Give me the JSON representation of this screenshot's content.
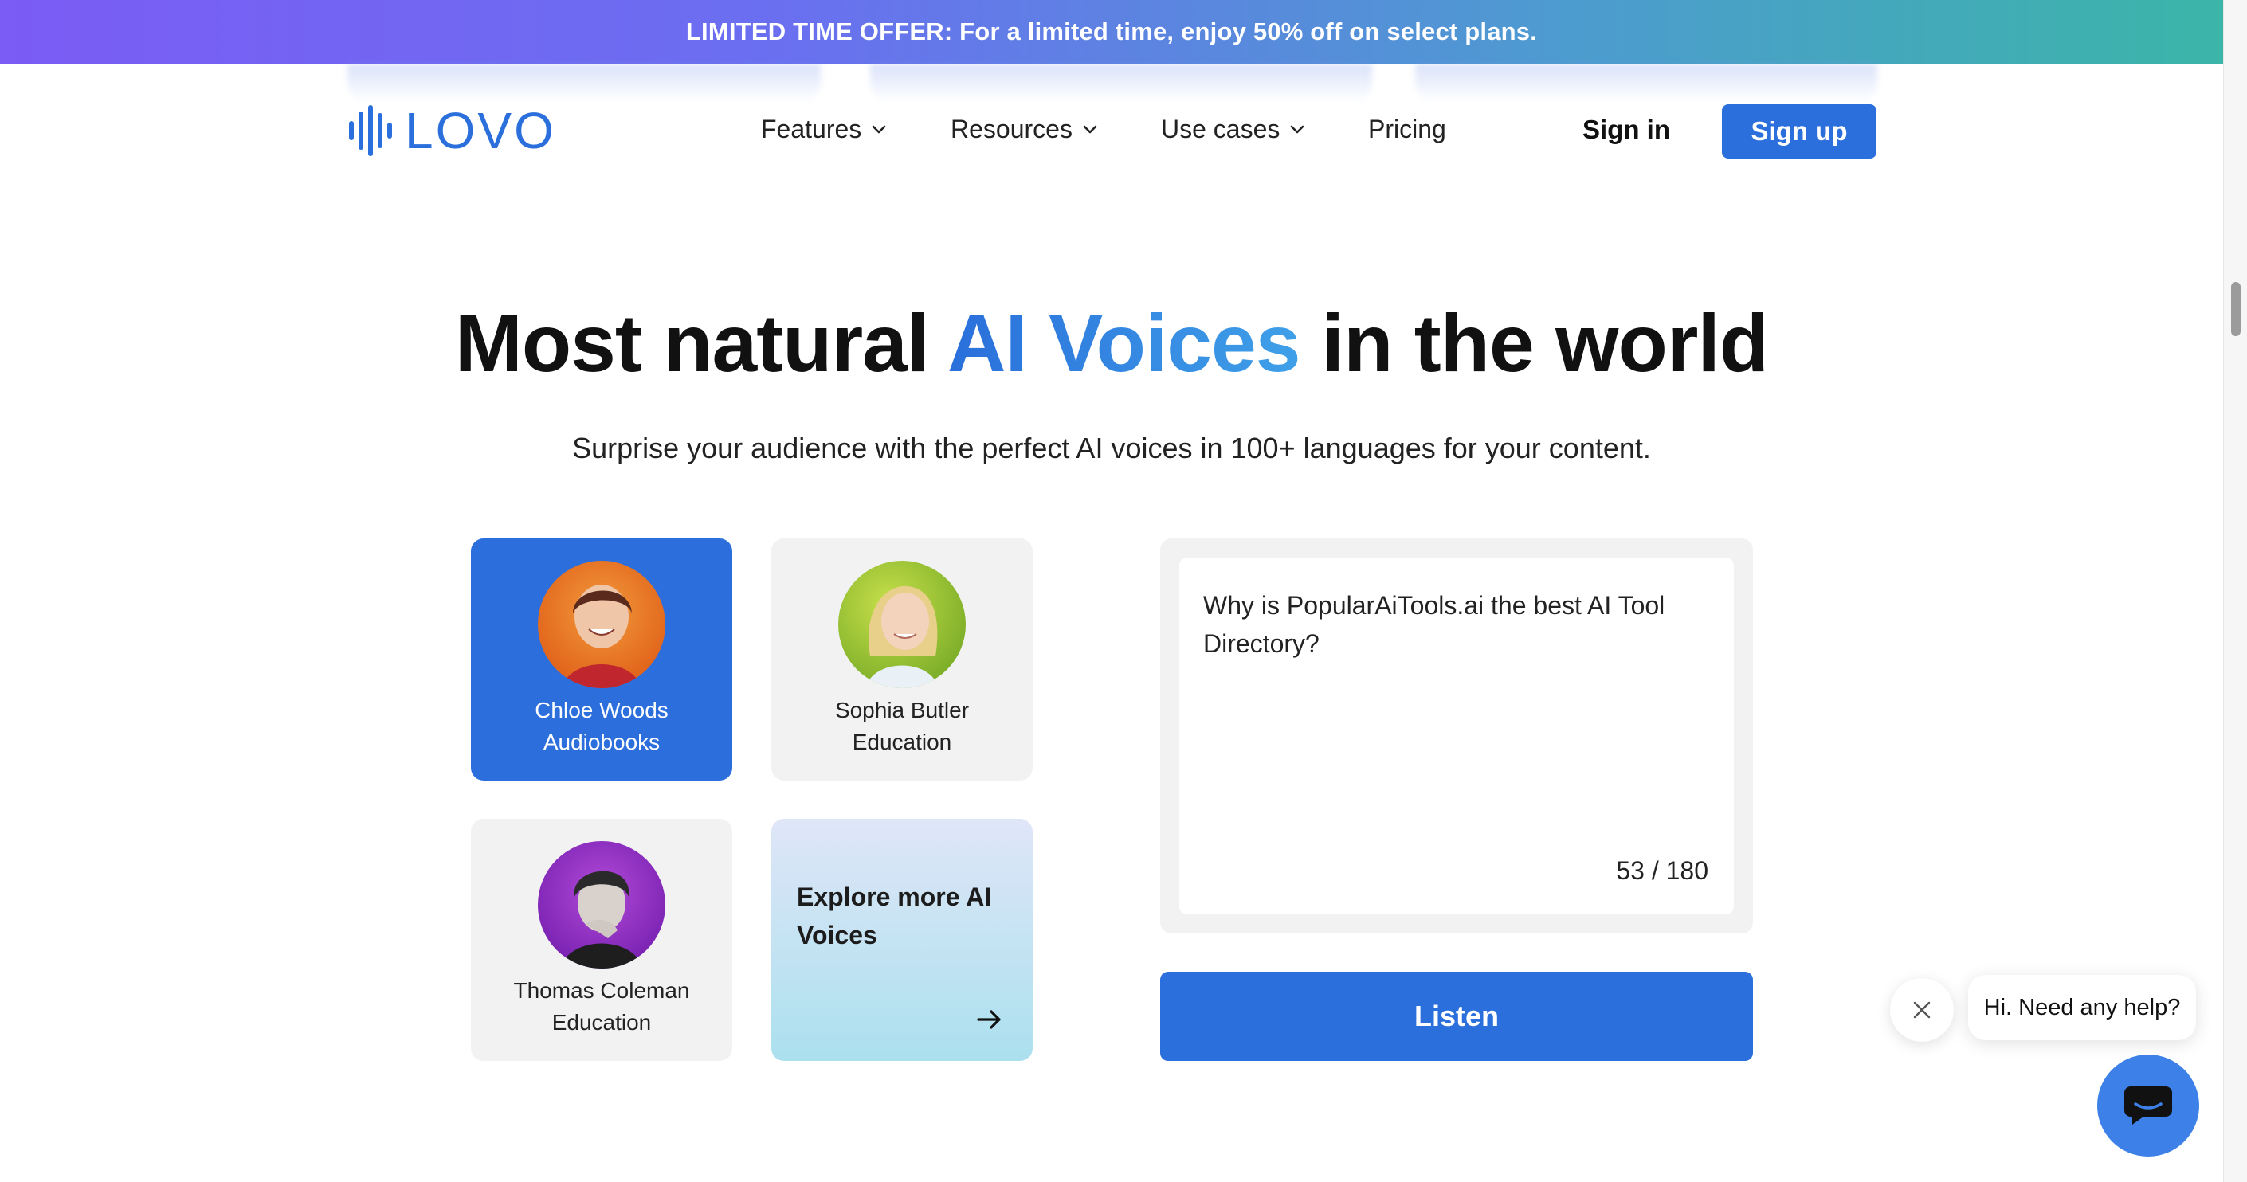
{
  "banner": {
    "text": "LIMITED TIME OFFER: For a limited time, enjoy 50% off on select plans."
  },
  "nav": {
    "logo_text": "LOVO",
    "items": [
      {
        "label": "Features",
        "has_dropdown": true
      },
      {
        "label": "Resources",
        "has_dropdown": true
      },
      {
        "label": "Use cases",
        "has_dropdown": true
      },
      {
        "label": "Pricing",
        "has_dropdown": false
      }
    ],
    "sign_in": "Sign in",
    "sign_up": "Sign up"
  },
  "hero": {
    "headline_before": "Most natural ",
    "headline_accent": "AI Voices",
    "headline_after": " in the world",
    "subheadline": "Surprise your audience with the perfect AI voices in 100+ languages for your content."
  },
  "voices": [
    {
      "name": "Chloe Woods",
      "category": "Audiobooks",
      "selected": true
    },
    {
      "name": "Sophia Butler",
      "category": "Education",
      "selected": false
    },
    {
      "name": "Thomas Coleman",
      "category": "Education",
      "selected": false
    }
  ],
  "explore": {
    "label": "Explore more AI Voices",
    "icon": "arrow-right-icon"
  },
  "textbox": {
    "text": "Why is PopularAiTools.ai the best AI Tool Directory?",
    "counter": "53 / 180"
  },
  "listen_button": "Listen",
  "chat": {
    "bubble_text": "Hi. Need any help?",
    "close_icon": "close-icon",
    "launcher_icon": "chat-icon"
  },
  "colors": {
    "brand_blue": "#2b6fdd",
    "accent_gradient_start": "#2a6fdb",
    "accent_gradient_end": "#3fa0e8",
    "banner_gradient_start": "#7b5cf5",
    "banner_gradient_end": "#3bb5a8"
  }
}
